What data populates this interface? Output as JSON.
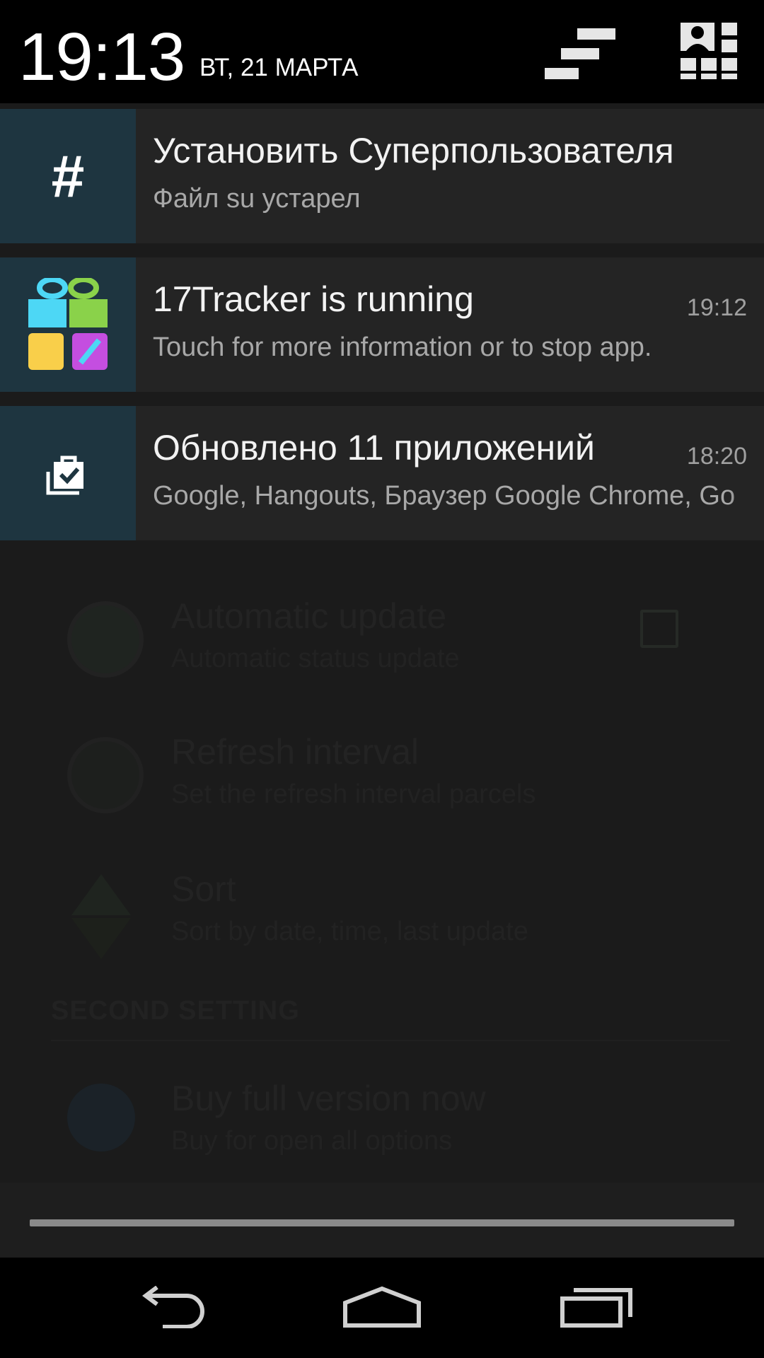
{
  "status_header": {
    "time": "19:13",
    "date": "ВТ, 21 МАРТА",
    "clear_icon": "clear-all-icon",
    "quick_settings_icon": "quick-settings-icon"
  },
  "notifications": [
    {
      "title": "Установить Суперпользователя",
      "text": "Файл su устарел",
      "time": "",
      "icon": "hash-icon"
    },
    {
      "title": "17Tracker is running",
      "text": "Touch for more information or to stop app.",
      "time": "19:12",
      "icon": "gift-icon"
    },
    {
      "title": "Обновлено 11 приложений",
      "text": "Google, Hangouts, Браузер Google Chrome, Google Play Музыка",
      "time": "18:20",
      "icon": "updated-apps-icon"
    }
  ],
  "background_app": {
    "settings": [
      {
        "title": "Automatic update",
        "subtitle": "Automatic status update",
        "checked": true
      },
      {
        "title": "Refresh interval",
        "subtitle": "Set the refresh interval parcels"
      },
      {
        "title": "Sort",
        "subtitle": "Sort by date, time, last update"
      }
    ],
    "section_header": "SECOND SETTING",
    "purchase": {
      "title": "Buy full version now",
      "subtitle": "Buy for open all options"
    }
  },
  "navbar": {
    "back_icon": "back-icon",
    "home_icon": "home-icon",
    "recents_icon": "recents-icon"
  },
  "colors": {
    "notif_bg": "#242424",
    "icon_bg": "#1e3540",
    "header_bg": "#000000"
  }
}
